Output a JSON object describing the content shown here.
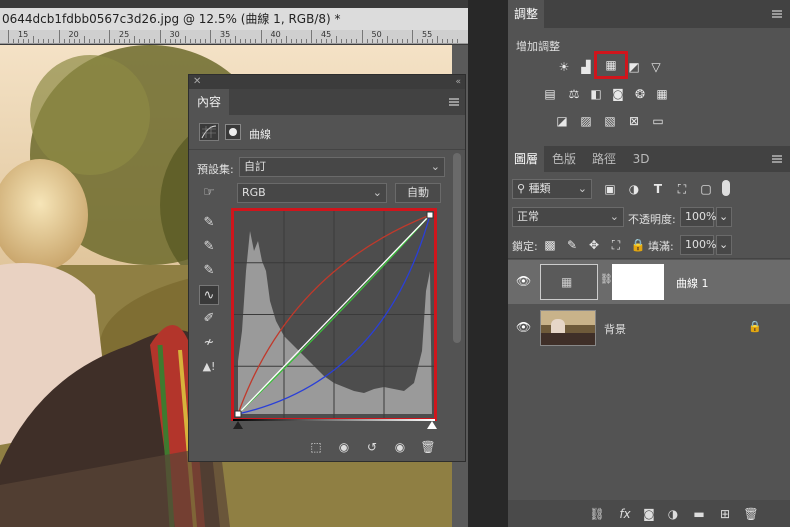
{
  "document": {
    "title": "0644dcb1fdbb0567c3d26.jpg @ 12.5% (曲線 1, RGB/8) *",
    "ruler_numbers": [
      "15",
      "20",
      "25",
      "30",
      "35",
      "40",
      "45",
      "50",
      "55"
    ]
  },
  "properties": {
    "tab_label": "內容",
    "adjustment_type": "曲線",
    "preset_label": "預設集:",
    "preset_value": "自訂",
    "channel_value": "RGB",
    "auto_button": "自動"
  },
  "adjustments_panel": {
    "tab_label": "調整",
    "subtitle": "增加調整",
    "highlighted_icon": "curves-icon",
    "highlight_color": "#d0151c"
  },
  "layers_panel": {
    "tabs": [
      "圖層",
      "色版",
      "路徑",
      "3D"
    ],
    "filter_value": "種類",
    "blend_mode": "正常",
    "opacity_label": "不透明度:",
    "opacity_value": "100%",
    "lock_label": "鎖定:",
    "fill_label": "填滿:",
    "fill_value": "100%",
    "layers": [
      {
        "name": "曲線 1"
      },
      {
        "name": "背景"
      }
    ]
  },
  "colors": {
    "highlight": "#d0151c",
    "curve_red": "#c0392b",
    "curve_green": "#3bbf3b",
    "curve_blue": "#2a3fd8",
    "curve_rgb": "#ffffff"
  }
}
